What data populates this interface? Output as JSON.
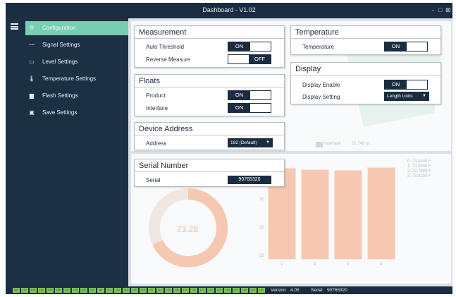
{
  "window": {
    "title": "Dashboard - V1.02",
    "controls": [
      "-",
      "□",
      "⊠"
    ]
  },
  "sidebar": {
    "items": [
      {
        "label": "Configuration",
        "icon": "gear-icon",
        "glyph": "⚙"
      },
      {
        "label": "Signal Settings",
        "icon": "signal-icon",
        "glyph": "〰"
      },
      {
        "label": "Level Settings",
        "icon": "level-icon",
        "glyph": "▭"
      },
      {
        "label": "Temperature Settings",
        "icon": "thermometer-icon",
        "glyph": "🌡"
      },
      {
        "label": "Flash Settings",
        "icon": "flash-icon",
        "glyph": "▆"
      },
      {
        "label": "Save Settings",
        "icon": "save-icon",
        "glyph": "▣"
      }
    ],
    "active_index": 0
  },
  "measurement": {
    "title": "Measurement",
    "auto_threshold": {
      "label": "Auto Threshold",
      "value": "ON"
    },
    "reverse_measure": {
      "label": "Reverse Measure",
      "value": "OFF"
    }
  },
  "floats": {
    "title": "Floats",
    "product": {
      "label": "Product",
      "value": "ON"
    },
    "interface": {
      "label": "Interface",
      "value": "ON"
    }
  },
  "device_address": {
    "title": "Device Address",
    "address": {
      "label": "Address",
      "value": "192 (Default)"
    }
  },
  "serial_number": {
    "title": "Serial Number",
    "serial": {
      "label": "Serial",
      "value": "90765320"
    }
  },
  "temperature": {
    "title": "Temperature",
    "temperature": {
      "label": "Temperature",
      "value": "ON"
    }
  },
  "display": {
    "title": "Display",
    "display_enable": {
      "label": "Display Enable",
      "value": "ON"
    },
    "display_setting": {
      "label": "Display Setting",
      "value": "Length Units"
    }
  },
  "background_dashboard": {
    "interface_label": "Interface",
    "interface_value": "21.749 in",
    "gauge_value": "73.28",
    "gauge_fraction": 0.68,
    "axis_labels": [
      "30",
      "20",
      "10"
    ],
    "legend": [
      "0: 73.4400 F",
      "1: 73.0600 F",
      "2: 72.7899 F",
      "3: 73.6399 F"
    ],
    "bar_labels": [
      "1",
      "2",
      "3",
      "4"
    ],
    "bar_values": [
      73.44,
      73.06,
      72.79,
      73.64
    ]
  },
  "statusbar": {
    "chips": [
      "101",
      "102",
      "103",
      "104",
      "105",
      "106",
      "107",
      "108",
      "109",
      "110",
      "111",
      "112",
      "113",
      "114",
      "115",
      "116",
      "117",
      "118",
      "119",
      "120",
      "121",
      "122",
      "123",
      "124",
      "125",
      "126",
      "127",
      "128",
      "129",
      "130"
    ],
    "version_label": "Version",
    "version": "4.05",
    "serial_label": "Serial",
    "serial": "90765320"
  },
  "colors": {
    "navy": "#1a2c40",
    "sidebar": "#1c3044",
    "accent": "#76cfb0",
    "bar": "#f6c8b2",
    "chip": "#7ec65a"
  }
}
